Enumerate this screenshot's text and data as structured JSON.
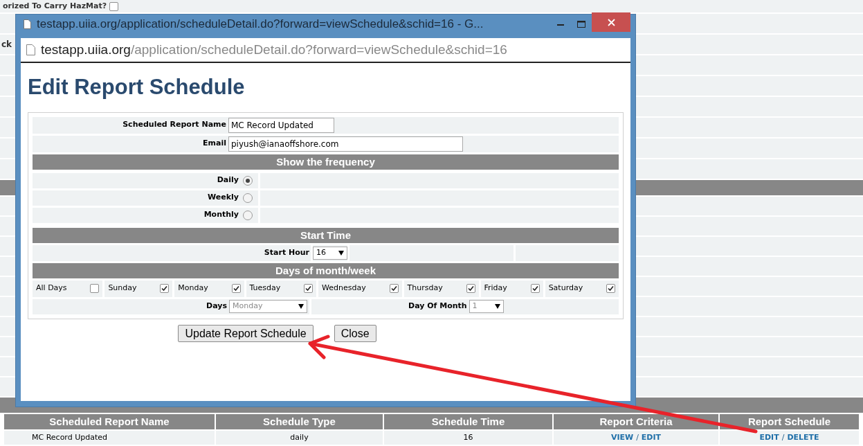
{
  "background": {
    "label": "orized To Carry HazMat?",
    "checked": false,
    "cut_label": "ck"
  },
  "window": {
    "title": "testapp.uiia.org/application/scheduleDetail.do?forward=viewSchedule&schid=16 - G...",
    "address_host": "testapp.uiia.org",
    "address_path": "/application/scheduleDetail.do?forward=viewSchedule&schid=16"
  },
  "page_title": "Edit Report Schedule",
  "fields": [
    {
      "label": "Scheduled Report Name",
      "value": "MC Record Updated",
      "kind": "short"
    },
    {
      "label": "Email",
      "value": "piyush@ianaoffshore.com",
      "kind": "long"
    }
  ],
  "frequency": {
    "heading": "Show the frequency",
    "options": [
      {
        "label": "Daily",
        "selected": true
      },
      {
        "label": "Weekly",
        "selected": false
      },
      {
        "label": "Monthly",
        "selected": false
      }
    ]
  },
  "start_time": {
    "heading": "Start Time",
    "label": "Start Hour",
    "value": "16"
  },
  "days": {
    "heading": "Days of month/week",
    "checkboxes": [
      {
        "label": "All Days",
        "checked": false
      },
      {
        "label": "Sunday",
        "checked": true
      },
      {
        "label": "Monday",
        "checked": true
      },
      {
        "label": "Tuesday",
        "checked": true
      },
      {
        "label": "Wednesday",
        "checked": true
      },
      {
        "label": "Thursday",
        "checked": true
      },
      {
        "label": "Friday",
        "checked": true
      },
      {
        "label": "Saturday",
        "checked": true
      }
    ],
    "days_select": {
      "label": "Days",
      "value": "Monday",
      "disabled": true
    },
    "dom_select": {
      "label": "Day Of Month",
      "value": "1",
      "disabled": true
    }
  },
  "buttons": [
    {
      "label": "Update Report Schedule"
    },
    {
      "label": "Close"
    }
  ],
  "table": {
    "columns": [
      "Scheduled Report Name",
      "Schedule Type",
      "Schedule Time",
      "Report Criteria",
      "Report Schedule"
    ],
    "rows": [
      {
        "cells": [
          "MC Record Updated",
          "daily",
          "16"
        ],
        "criteria_links": [
          "VIEW",
          "EDIT"
        ],
        "schedule_links": [
          "EDIT",
          "DELETE"
        ],
        "separator": "/"
      }
    ]
  }
}
